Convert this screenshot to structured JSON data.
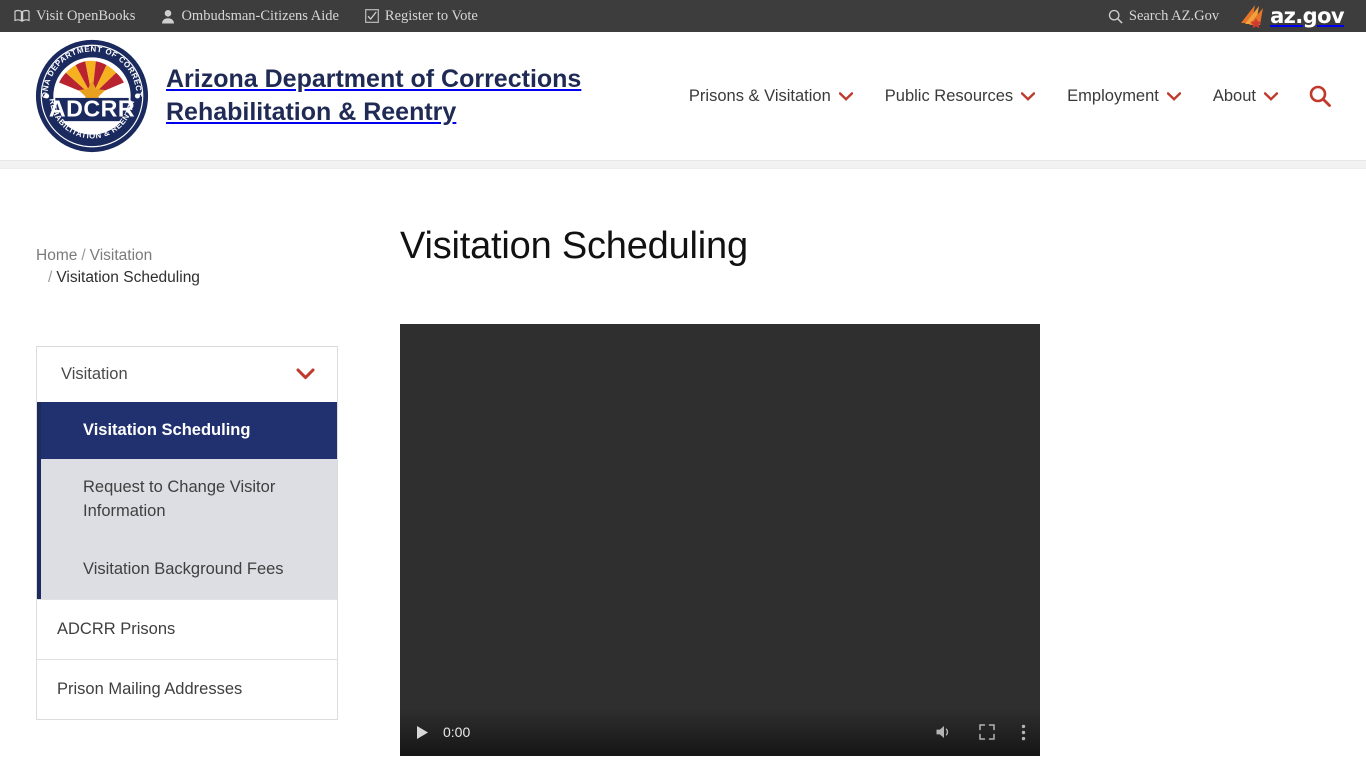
{
  "utility_bar": {
    "links": [
      {
        "label": "Visit OpenBooks",
        "icon": "open-book-icon"
      },
      {
        "label": "Ombudsman-Citizens Aide",
        "icon": "person-icon"
      },
      {
        "label": "Register to Vote",
        "icon": "checkbox-check-icon"
      }
    ],
    "search_label": "Search AZ.Gov",
    "search_icon": "search-icon",
    "azgov_logo_text": "az.gov",
    "azgov_star_color": "#e8732a",
    "background_color": "#3d3d3d"
  },
  "header": {
    "logo_alt": "ADCRR",
    "logo_seal_text_top": "ARIZONA DEPARTMENT OF CORRECTIONS",
    "logo_seal_text_bottom": "REHABILITATION & REENTRY",
    "logo_seal_center": "ADCRR",
    "site_title_line1": "Arizona Department of Corrections",
    "site_title_line2": "Rehabilitation & Reentry",
    "title_color": "#1f2a55",
    "nav": [
      {
        "label": "Prisons & Visitation",
        "has_dropdown": true
      },
      {
        "label": "Public Resources",
        "has_dropdown": true
      },
      {
        "label": "Employment",
        "has_dropdown": true
      },
      {
        "label": "About",
        "has_dropdown": true
      }
    ],
    "search_icon": "search-icon",
    "accent_color": "#c0392b"
  },
  "breadcrumb": {
    "home": "Home",
    "sep": "/",
    "parent": "Visitation",
    "current": "Visitation Scheduling"
  },
  "main": {
    "page_title": "Visitation Scheduling"
  },
  "sidebar": {
    "group_label": "Visitation",
    "group_chevron_icon": "chevron-down-icon",
    "active_item": "Visitation Scheduling",
    "sub_items": [
      "Request to Change Visitor Information",
      "Visitation Background Fees"
    ],
    "items": [
      "ADCRR Prisons",
      "Prison Mailing Addresses"
    ],
    "active_background": "#21316f",
    "sub_background": "#dcdee4",
    "stripe_color": "#1d2a5e"
  },
  "video": {
    "current_time": "0:00",
    "play_icon": "play-icon",
    "volume_icon": "volume-mute-icon",
    "fullscreen_icon": "fullscreen-icon",
    "more_icon": "more-options-icon",
    "background_color": "#2f2f2f"
  }
}
